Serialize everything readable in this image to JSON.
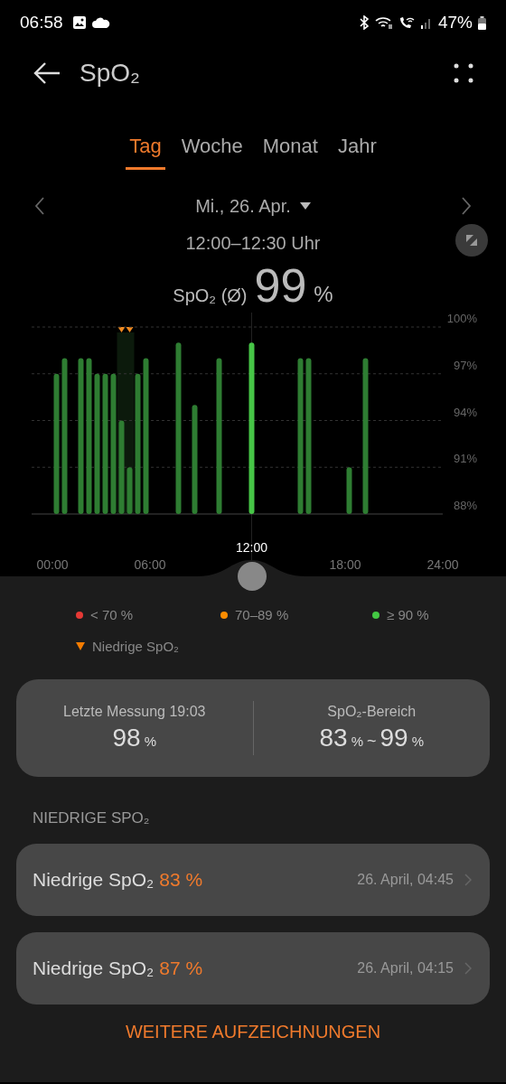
{
  "status_bar": {
    "time": "06:58",
    "battery": "47%"
  },
  "header": {
    "title": "SpO₂"
  },
  "tabs": [
    {
      "label": "Tag",
      "selected": true
    },
    {
      "label": "Woche",
      "selected": false
    },
    {
      "label": "Monat",
      "selected": false
    },
    {
      "label": "Jahr",
      "selected": false
    }
  ],
  "date": {
    "label": "Mi., 26. Apr."
  },
  "range": "12:00–12:30 Uhr",
  "average": {
    "label": "SpO₂ (Ø)",
    "value": "99",
    "unit": "%"
  },
  "chart_data": {
    "type": "bar",
    "x": [
      0,
      0.5,
      1.5,
      2,
      2.5,
      3,
      3.5,
      4,
      4.5,
      5,
      5.5,
      7.5,
      8.5,
      10,
      12,
      15,
      15.5,
      18,
      19
    ],
    "series": [
      {
        "color": "#2e7d32",
        "values": [
          97,
          98,
          98,
          98,
          97,
          97,
          97,
          94,
          91,
          97,
          98,
          99,
          95,
          98,
          null,
          98,
          98,
          91,
          98
        ]
      },
      {
        "color": "#47c547",
        "values": [
          null,
          null,
          null,
          null,
          null,
          null,
          null,
          null,
          null,
          null,
          null,
          null,
          null,
          null,
          99,
          null,
          null,
          null,
          null
        ]
      }
    ],
    "grid": true,
    "xlim": [
      0,
      24
    ],
    "ylim": [
      88,
      100
    ],
    "xticks": [
      {
        "value": 0,
        "label": "00:00"
      },
      {
        "value": 6,
        "label": "06:00"
      },
      {
        "value": 18,
        "label": "18:00"
      },
      {
        "value": 24,
        "label": "24:00"
      }
    ],
    "yticks": [
      {
        "value": 100,
        "label": "100%"
      },
      {
        "value": 97,
        "label": "97%"
      },
      {
        "value": 94,
        "label": "94%"
      },
      {
        "value": 91,
        "label": "91%"
      },
      {
        "value": 88,
        "label": "88%"
      }
    ]
  },
  "low_markers": [
    false,
    false,
    false,
    false,
    false,
    false,
    false,
    true,
    true,
    false,
    false,
    false,
    false,
    false,
    false,
    false,
    false,
    false,
    false
  ],
  "selected_time": "12:00",
  "legend": [
    {
      "kind": "dot",
      "label": "< 70 %",
      "color": "#e53935"
    },
    {
      "kind": "dot",
      "label": "70–89 %",
      "color": "#fb8c00"
    },
    {
      "kind": "dot",
      "label": "≥ 90 %",
      "color": "#43c743"
    },
    {
      "kind": "triangle",
      "label": "Niedrige SpO₂",
      "color": "#f57c00"
    }
  ],
  "summary": [
    {
      "label": "Letzte Messung 19:03",
      "parts": [
        {
          "kind": "number",
          "text": "98"
        },
        {
          "kind": "unit",
          "text": "%"
        }
      ]
    },
    {
      "label": "SpO₂-Bereich",
      "parts": [
        {
          "kind": "number",
          "text": "83"
        },
        {
          "kind": "unit",
          "text": "%"
        },
        {
          "kind": "separator",
          "text": "~"
        },
        {
          "kind": "number",
          "text": "99"
        },
        {
          "kind": "unit",
          "text": "%"
        }
      ]
    }
  ],
  "low_section": {
    "heading": "NIEDRIGE SPO₂",
    "records": [
      {
        "label": "Niedrige SpO₂",
        "value": "83 %",
        "date": "26. April, 04:45"
      },
      {
        "label": "Niedrige SpO₂",
        "value": "87 %",
        "date": "26. April, 04:15"
      }
    ]
  },
  "more_button": "WEITERE AUFZEICHNUNGEN"
}
